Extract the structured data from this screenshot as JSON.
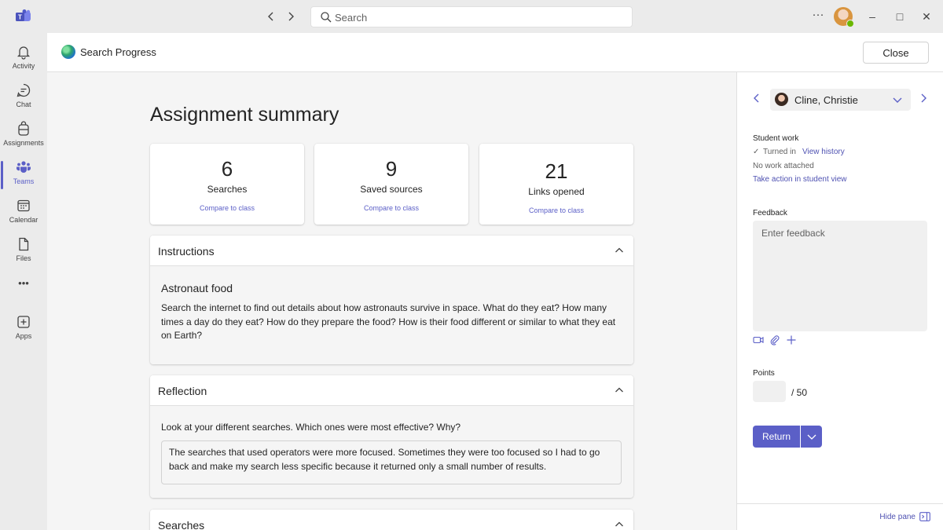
{
  "titlebar": {
    "search_placeholder": "Search",
    "more_label": "···",
    "minimize": "–",
    "maximize": "□",
    "close": "✕"
  },
  "rail": {
    "items": [
      {
        "label": "Activity",
        "icon": "bell-icon"
      },
      {
        "label": "Chat",
        "icon": "chat-icon"
      },
      {
        "label": "Assignments",
        "icon": "backpack-icon"
      },
      {
        "label": "Teams",
        "icon": "teams-icon",
        "active": true
      },
      {
        "label": "Calendar",
        "icon": "calendar-icon"
      },
      {
        "label": "Files",
        "icon": "file-icon"
      },
      {
        "label": "",
        "icon": "more-icon"
      },
      {
        "label": "Apps",
        "icon": "apps-icon"
      }
    ],
    "more_label": "•••"
  },
  "app": {
    "title": "Search Progress",
    "close_label": "Close"
  },
  "summary": {
    "title": "Assignment summary",
    "stats": [
      {
        "value": "6",
        "label": "Searches",
        "compare": "Compare to class"
      },
      {
        "value": "9",
        "label": "Saved sources",
        "compare": "Compare to class"
      },
      {
        "value": "21",
        "label": "Links opened",
        "compare": "Compare to class"
      }
    ]
  },
  "instructions": {
    "header": "Instructions",
    "title": "Astronaut food",
    "text": "Search the internet to find out details about how astronauts survive in space. What do they eat? How many times a day do they eat? How do they prepare the food? How is their food different or similar to what they eat on Earth?"
  },
  "reflection": {
    "header": "Reflection",
    "question": "Look at your different searches. Which ones were most effective? Why?",
    "answer": "The searches that used operators were more focused. Sometimes they were too focused so I had to go back and make my search less specific because it returned only a small number of results."
  },
  "searches": {
    "header": "Searches"
  },
  "pane": {
    "student_name": "Cline, Christie",
    "student_work_label": "Student work",
    "status_check": "✓",
    "status_text": "Turned in",
    "view_history": "View history",
    "no_work": "No work attached",
    "take_action": "Take action in student view",
    "feedback_label": "Feedback",
    "feedback_placeholder": "Enter feedback",
    "points_label": "Points",
    "points_value": "",
    "points_max": "/ 50",
    "return_label": "Return",
    "hide_pane": "Hide pane"
  },
  "colors": {
    "accent": "#5b5fc7",
    "link": "#4f52b2"
  }
}
